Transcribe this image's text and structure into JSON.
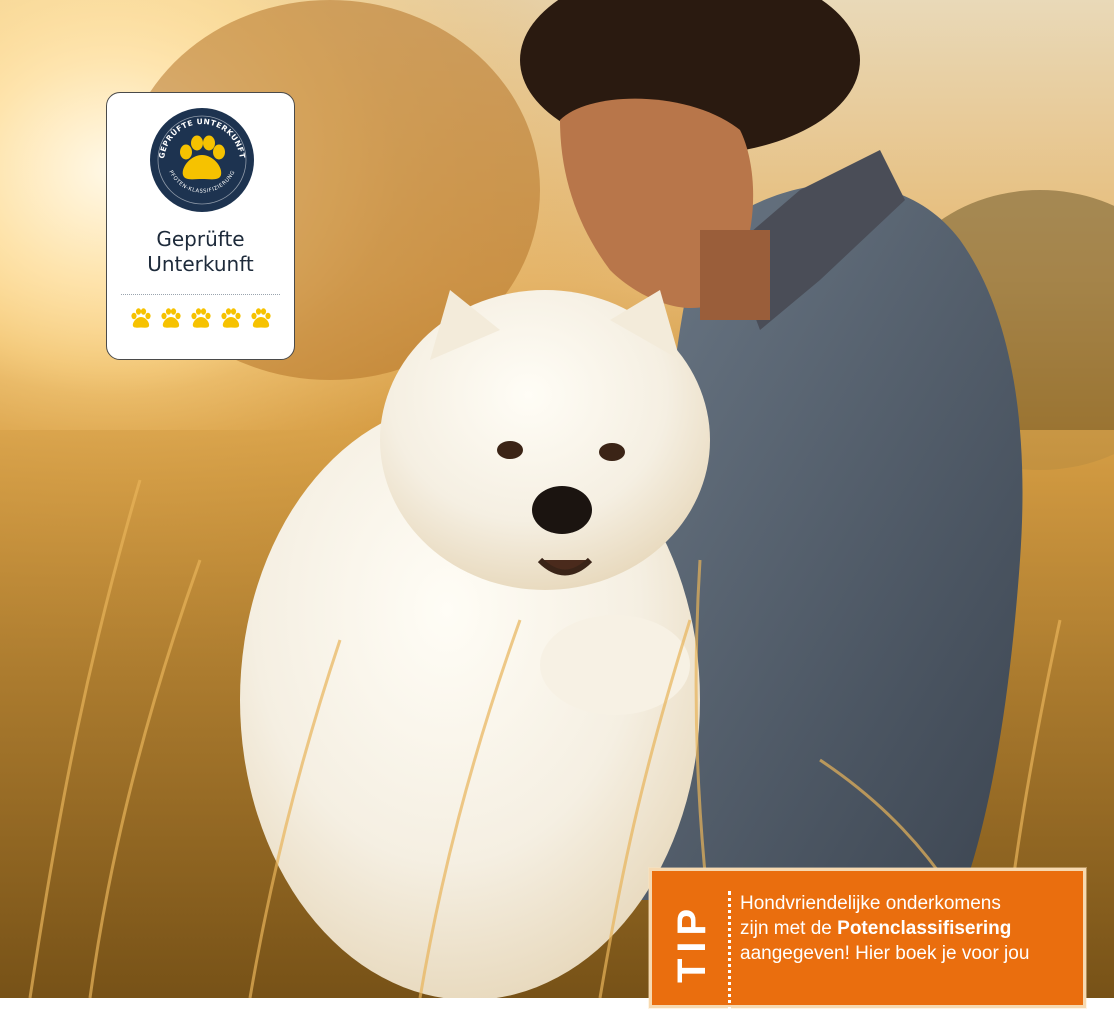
{
  "badge": {
    "seal_text_top": "GEPRÜFTE UNTERKUNFT",
    "seal_text_bottom": "PFOTEN-KLASSIFIZIERUNG",
    "title_line1": "Geprüfte",
    "title_line2": "Unterkunft",
    "rating_icons": [
      "paw-icon",
      "paw-icon",
      "paw-icon",
      "paw-icon",
      "paw-icon"
    ],
    "colors": {
      "navy": "#1d3350",
      "yellow": "#f6c200"
    }
  },
  "tip": {
    "label": "TIP",
    "text_line1": "Hondvriendelijke onderkomens",
    "text_line2_pre": "zijn met de ",
    "text_line2_bold": "Potenclassifisering",
    "text_line3": "aangegeven! Hier boek je voor jou",
    "colors": {
      "background": "#ea6e0e",
      "border": "#f7d9b0"
    }
  }
}
